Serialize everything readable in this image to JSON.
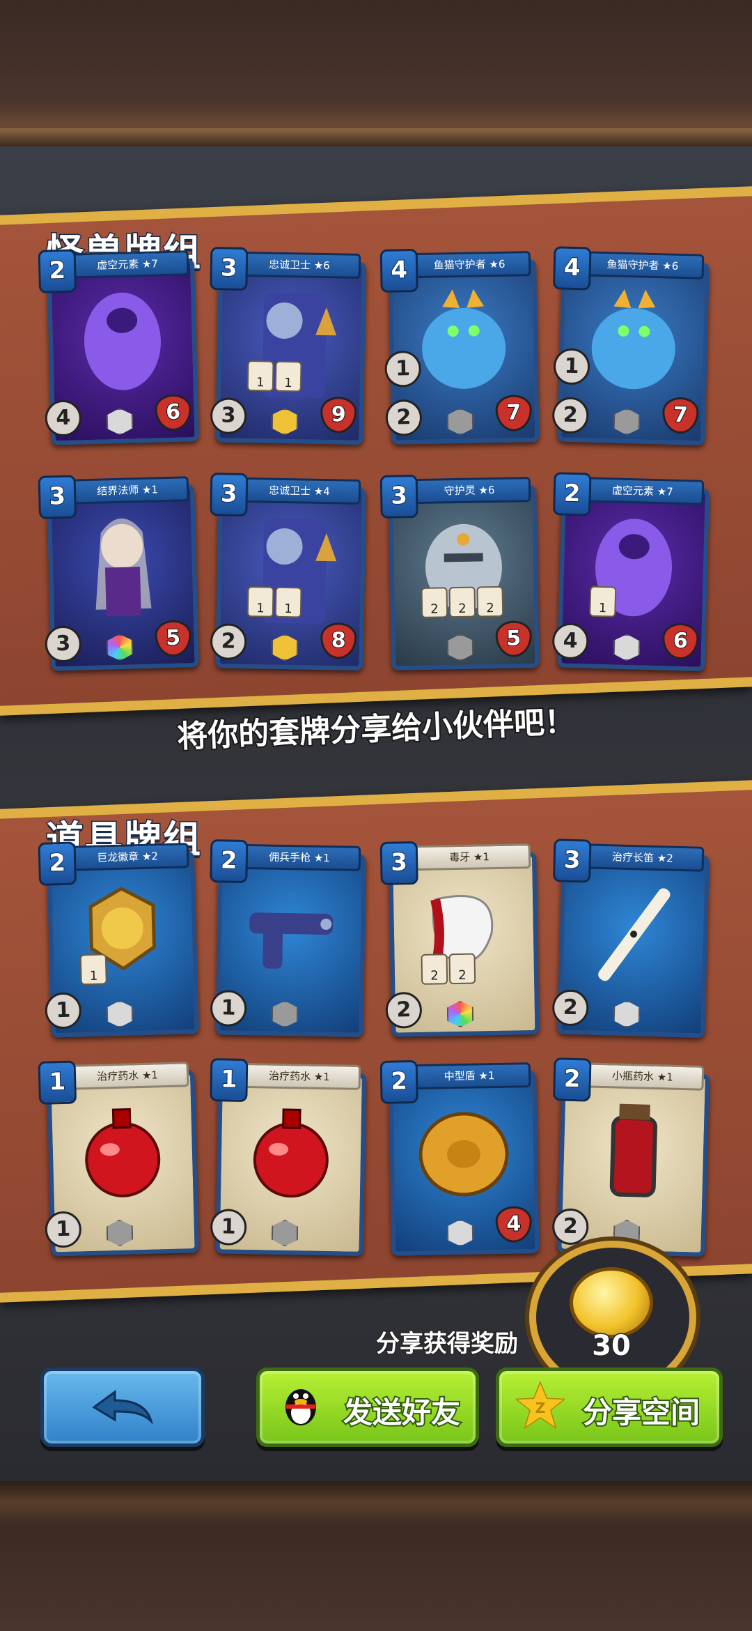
{
  "monster_deck": {
    "title": "怪兽牌组",
    "cards": [
      {
        "name": "虚空元素 ★7",
        "cost": "2",
        "attack": "4",
        "health": "6",
        "theme": "void"
      },
      {
        "name": "忠诚卫士 ★6",
        "cost": "3",
        "attack": "3",
        "health": "9",
        "theme": "guard",
        "badges": [
          "1",
          "1"
        ]
      },
      {
        "name": "鱼猫守护者 ★6",
        "cost": "4",
        "attack": "2",
        "health": "7",
        "theme": "cat",
        "left_stat": "1"
      },
      {
        "name": "鱼猫守护者 ★6",
        "cost": "4",
        "attack": "2",
        "health": "7",
        "theme": "cat",
        "left_stat": "1"
      },
      {
        "name": "结界法师 ★1",
        "cost": "3",
        "attack": "3",
        "health": "5",
        "theme": "mage"
      },
      {
        "name": "忠诚卫士 ★4",
        "cost": "3",
        "attack": "2",
        "health": "8",
        "theme": "guard",
        "badges": [
          "1",
          "1"
        ]
      },
      {
        "name": "守护灵 ★6",
        "cost": "3",
        "attack": "",
        "health": "5",
        "theme": "spirit",
        "badges": [
          "2",
          "2",
          "2"
        ]
      },
      {
        "name": "虚空元素 ★7",
        "cost": "2",
        "attack": "4",
        "health": "6",
        "theme": "void",
        "badges": [
          "1"
        ]
      }
    ]
  },
  "share_prompt": "将你的套牌分享给小伙伴吧！",
  "item_deck": {
    "title": "道具牌组",
    "cards": [
      {
        "name": "巨龙徽章 ★2",
        "cost": "2",
        "attack": "1",
        "theme": "medal",
        "badges": [
          "1"
        ]
      },
      {
        "name": "佣兵手枪 ★1",
        "cost": "2",
        "attack": "1",
        "theme": "pistol"
      },
      {
        "name": "毒牙 ★1",
        "cost": "3",
        "attack": "2",
        "theme": "fang",
        "badges": [
          "2",
          "2"
        ]
      },
      {
        "name": "治疗长笛 ★2",
        "cost": "3",
        "attack": "2",
        "theme": "flute"
      },
      {
        "name": "治疗药水 ★1",
        "cost": "1",
        "attack": "1",
        "theme": "potion"
      },
      {
        "name": "治疗药水 ★1",
        "cost": "1",
        "attack": "1",
        "theme": "potion"
      },
      {
        "name": "中型盾 ★1",
        "cost": "2",
        "health": "4",
        "theme": "shield"
      },
      {
        "name": "小瓶药水 ★1",
        "cost": "2",
        "attack": "2",
        "theme": "vial"
      }
    ]
  },
  "reward": {
    "label": "分享获得奖励",
    "amount": "30"
  },
  "buttons": {
    "back": "back-arrow-icon",
    "send_friend": "发送好友",
    "share_space": "分享空间"
  },
  "colors": {
    "banner": "#a4543a",
    "banner_trim": "#e0b044",
    "card_border": "#234e8a",
    "button_green": "#8fd61e",
    "button_blue": "#3f94d8"
  }
}
